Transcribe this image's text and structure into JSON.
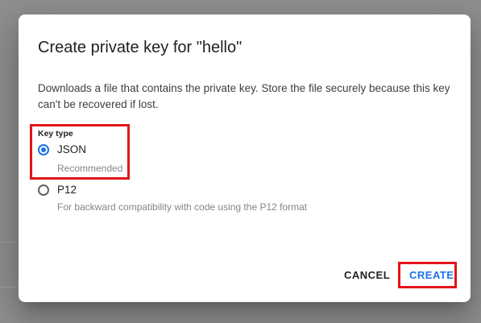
{
  "dialog": {
    "title": "Create private key for \"hello\"",
    "description": "Downloads a file that contains the private key. Store the file securely because this key can't be recovered if lost.",
    "key_type_label": "Key type",
    "options": [
      {
        "label": "JSON",
        "hint": "Recommended",
        "selected": true
      },
      {
        "label": "P12",
        "hint": "For backward compatibility with code using the P12 format",
        "selected": false
      }
    ],
    "cancel_label": "CANCEL",
    "create_label": "CREATE"
  },
  "colors": {
    "accent": "#1a73e8",
    "highlight": "#e2151b",
    "backdrop": "#8e8e8e"
  }
}
